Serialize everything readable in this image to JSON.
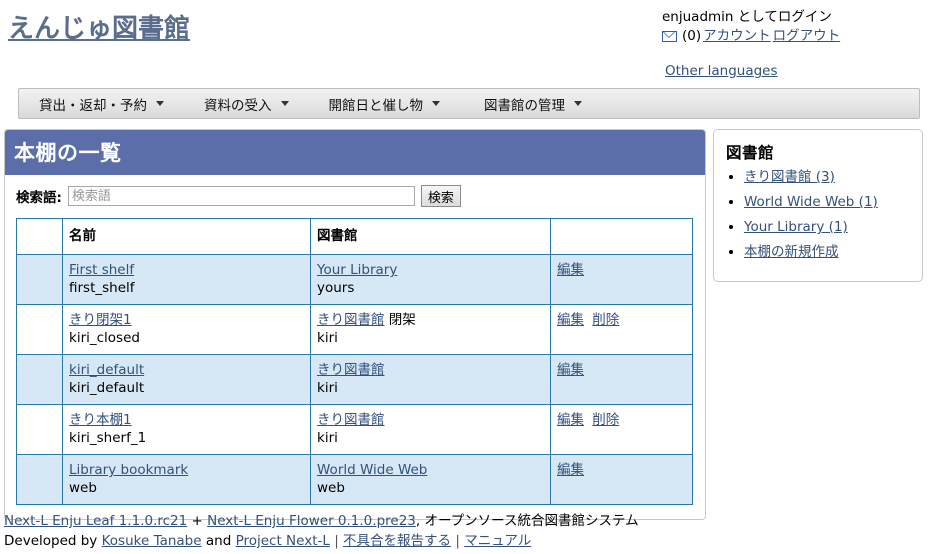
{
  "header": {
    "site_title": "えんじゅ図書館",
    "user_status": "enjuadmin としてログイン",
    "message_icon": "envelope-icon",
    "message_count": "(0)",
    "account_link": "アカウント",
    "logout_link": "ログアウト",
    "other_languages_link": "Other languages"
  },
  "nav": {
    "items": [
      {
        "label": "貸出・返却・予約",
        "caret": "chevron-down-icon"
      },
      {
        "label": "資料の受入",
        "caret": "chevron-down-icon"
      },
      {
        "label": "開館日と催し物",
        "caret": "chevron-down-icon"
      },
      {
        "label": "図書館の管理",
        "caret": "chevron-down-icon"
      }
    ]
  },
  "main": {
    "panel_title": "本棚の一覧",
    "search": {
      "label": "検索語:",
      "placeholder": "検索語",
      "value": "",
      "button_label": "検索"
    },
    "table": {
      "headers": [
        "",
        "名前",
        "図書館",
        ""
      ],
      "rows": [
        {
          "name_link": "First shelf",
          "name_code": "first_shelf",
          "library_link": "Your Library",
          "library_extra": "",
          "library_code": "yours",
          "actions": [
            "編集"
          ]
        },
        {
          "name_link": "きり閉架1",
          "name_code": "kiri_closed",
          "library_link": "きり図書館",
          "library_extra": "閉架",
          "library_code": "kiri",
          "actions": [
            "編集",
            "削除"
          ]
        },
        {
          "name_link": "kiri_default",
          "name_code": "kiri_default",
          "library_link": "きり図書館",
          "library_extra": "",
          "library_code": "kiri",
          "actions": [
            "編集"
          ]
        },
        {
          "name_link": "きり本棚1",
          "name_code": "kiri_sherf_1",
          "library_link": "きり図書館",
          "library_extra": "",
          "library_code": "kiri",
          "actions": [
            "編集",
            "削除"
          ]
        },
        {
          "name_link": "Library bookmark",
          "name_code": "web",
          "library_link": "World Wide Web",
          "library_extra": "",
          "library_code": "web",
          "actions": [
            "編集"
          ]
        }
      ]
    }
  },
  "sidebar": {
    "title": "図書館",
    "items": [
      {
        "label": "きり図書館 (3)"
      },
      {
        "label": "World Wide Web (1)"
      },
      {
        "label": "Your Library (1)"
      },
      {
        "label": "本棚の新規作成"
      }
    ]
  },
  "footer": {
    "leaf_link": "Next-L Enju Leaf 1.1.0.rc21",
    "plus": "+",
    "flower_link": "Next-L Enju Flower 0.1.0.pre23",
    "tagline": ", オープンソース統合図書館システム",
    "developed_by": "Developed by",
    "author_link": "Kosuke Tanabe",
    "and": "and",
    "project_link": "Project Next-L",
    "sep1": "|",
    "bug_link": "不具合を報告する",
    "sep2": "|",
    "manual_link": "マニュアル"
  },
  "colors": {
    "panel_header": "#5b6ea9",
    "row_stripe": "#d6e7f5",
    "table_border": "#2878a8",
    "link": "#33517a",
    "site_title": "#5a6d8c"
  }
}
